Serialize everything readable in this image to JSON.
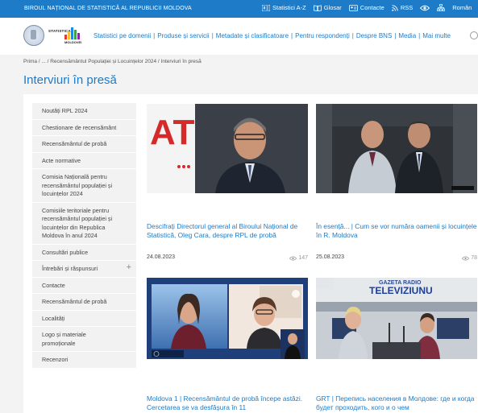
{
  "topbar": {
    "org": "BIROUL NAȚIONAL DE STATISTICĂ AL REPUBLICII MOLDOVA",
    "links": [
      {
        "icon": "abc-list-icon",
        "label": "Statistici A-Z"
      },
      {
        "icon": "book-icon",
        "label": "Glosar"
      },
      {
        "icon": "contact-card-icon",
        "label": "Contacte"
      },
      {
        "icon": "rss-icon",
        "label": "RSS"
      },
      {
        "icon": "eye-icon",
        "label": ""
      },
      {
        "icon": "sitemap-icon",
        "label": ""
      },
      {
        "icon": "",
        "label": "Român"
      }
    ]
  },
  "header": {
    "logo_text_top": "STATISTICA",
    "logo_text_bottom": "MOLDOVEI",
    "logo_colors": [
      "#e53935",
      "#fbc02d",
      "#1e88e5",
      "#43a047",
      "#8e24aa"
    ],
    "nav": [
      "Statistici pe domenii",
      "Produse și servicii",
      "Metadate și clasificatoare",
      "Pentru respondenți",
      "Despre BNS",
      "Media",
      "Mai multe"
    ]
  },
  "breadcrumb": "Prima / ... / Recensământul Populației și Locuințelor 2024 / Interviuri în presă",
  "page_title": "Interviuri în presă",
  "sidebar": {
    "items": [
      {
        "label": "Noutăți RPL 2024",
        "has_plus": false
      },
      {
        "label": "Chestionare de recensământ",
        "has_plus": false
      },
      {
        "label": "Recensământul de probă",
        "has_plus": false
      },
      {
        "label": "Acte normative",
        "has_plus": false
      },
      {
        "label": "Comisia Națională pentru recensământul populației și locuințelor 2024",
        "has_plus": false
      },
      {
        "label": "Comisiile teritoriale pentru recensământul populației și locuințelor din Republica Moldova în anul 2024",
        "has_plus": false
      },
      {
        "label": "Consultări publice",
        "has_plus": false
      },
      {
        "label": "Întrebări și răspunsuri",
        "has_plus": true
      },
      {
        "label": "Contacte",
        "has_plus": false
      },
      {
        "label": "Recensământul de probă",
        "has_plus": false
      },
      {
        "label": "Localități",
        "has_plus": false
      },
      {
        "label": "Logo și materiale promoționale",
        "has_plus": false
      },
      {
        "label": "Recenzori",
        "has_plus": false
      }
    ]
  },
  "cards": [
    {
      "title": "Descifrați Directorul general al Biroului Național de Statistică, Oleg Cara, despre RPL de probă",
      "date": "24.08.2023",
      "views": "147"
    },
    {
      "title": "În esență... | Cum se vor număra oamenii și locuințele în R. Moldova",
      "date": "25.08.2023",
      "views": "78"
    },
    {
      "title": "Moldova 1 | Recensământul de probă începe astăzi. Cercetarea se va desfășura în 11",
      "date": "",
      "views": ""
    },
    {
      "title": "GRT | Перепись населения в Молдове: где и когда будет проходить, кого и о чем",
      "date": "",
      "views": ""
    }
  ],
  "thumbs": {
    "card1_logo": "AT",
    "card4_banner": "TELEVIZIUNU",
    "card4_banner_top": "GAZETA RADIO"
  },
  "colors": {
    "accent": "#1d7bc8",
    "page_bg": "#f3f3f3",
    "sidebar_bg": "#f2f2f2"
  }
}
